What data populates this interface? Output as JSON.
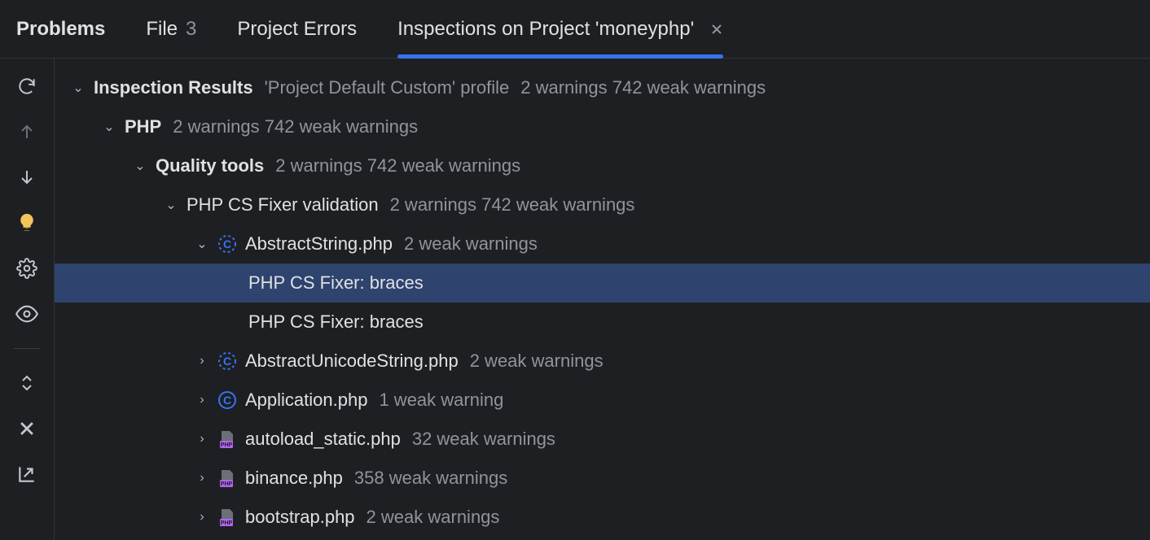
{
  "tabs": {
    "problems": "Problems",
    "file_label": "File",
    "file_count": "3",
    "project_errors": "Project Errors",
    "inspections": "Inspections on Project 'moneyphp'"
  },
  "tree": {
    "root_label": "Inspection Results",
    "root_meta_profile": "'Project Default Custom' profile",
    "root_meta_counts": "2 warnings 742 weak warnings",
    "php_label": "PHP",
    "php_meta": "2 warnings 742 weak warnings",
    "quality_label": "Quality tools",
    "quality_meta": "2 warnings 742 weak warnings",
    "fixer_label": "PHP CS Fixer validation",
    "fixer_meta": "2 warnings 742 weak warnings",
    "files": [
      {
        "name": "AbstractString.php",
        "meta": "2 weak warnings",
        "icon": "class-dotted",
        "expanded": true,
        "issues": [
          "PHP CS Fixer: braces",
          "PHP CS Fixer: braces"
        ]
      },
      {
        "name": "AbstractUnicodeString.php",
        "meta": "2 weak warnings",
        "icon": "class-dotted",
        "expanded": false
      },
      {
        "name": "Application.php",
        "meta": "1 weak warning",
        "icon": "class-solid",
        "expanded": false
      },
      {
        "name": "autoload_static.php",
        "meta": "32 weak warnings",
        "icon": "php",
        "expanded": false
      },
      {
        "name": "binance.php",
        "meta": "358 weak warnings",
        "icon": "php",
        "expanded": false
      },
      {
        "name": "bootstrap.php",
        "meta": "2 weak warnings",
        "icon": "php",
        "expanded": false
      }
    ]
  },
  "selected_issue_index": 0
}
